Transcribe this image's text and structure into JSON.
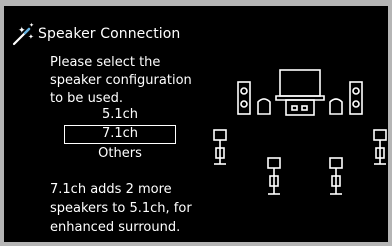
{
  "header": {
    "title": "Speaker Connection",
    "icon": "magic-wand-icon"
  },
  "description": {
    "lines": [
      "Please select the",
      "speaker configuration",
      "to be used."
    ]
  },
  "options": [
    {
      "label": "5.1ch",
      "selected": false
    },
    {
      "label": "7.1ch",
      "selected": true
    },
    {
      "label": "Others",
      "selected": false
    }
  ],
  "note": {
    "lines": [
      "7.1ch adds 2 more",
      "speakers to 5.1ch, for",
      "enhanced surround."
    ]
  },
  "colors": {
    "background": "#000000",
    "frame": "#b5b5b5",
    "text": "#ffffff"
  }
}
